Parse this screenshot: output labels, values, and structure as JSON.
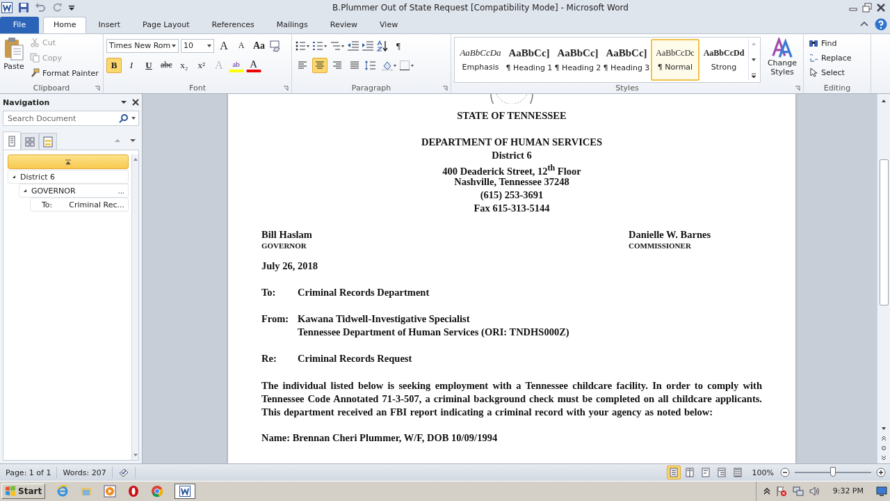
{
  "window": {
    "title": "B.Plummer Out of State Request [Compatibility Mode]  -  Microsoft Word"
  },
  "ribbon_tabs": [
    {
      "label": "File",
      "kind": "file",
      "selected": false
    },
    {
      "label": "Home",
      "kind": "tab",
      "selected": true
    },
    {
      "label": "Insert",
      "kind": "tab",
      "selected": false
    },
    {
      "label": "Page Layout",
      "kind": "tab",
      "selected": false
    },
    {
      "label": "References",
      "kind": "tab",
      "selected": false
    },
    {
      "label": "Mailings",
      "kind": "tab",
      "selected": false
    },
    {
      "label": "Review",
      "kind": "tab",
      "selected": false
    },
    {
      "label": "View",
      "kind": "tab",
      "selected": false
    }
  ],
  "clipboard": {
    "paste": "Paste",
    "cut": "Cut",
    "copy": "Copy",
    "format_painter": "Format Painter",
    "label": "Clipboard"
  },
  "font": {
    "name": "Times New Rom",
    "size": "10",
    "label": "Font",
    "top_buttons": [
      {
        "label": "A",
        "kind": "grow"
      },
      {
        "label": "A",
        "kind": "shrink"
      },
      {
        "label": "Aa",
        "kind": "case"
      }
    ],
    "buttons": [
      {
        "label": "B",
        "kind": "bold",
        "selected": true
      },
      {
        "label": "I",
        "kind": "italic",
        "selected": false
      },
      {
        "label": "U",
        "kind": "underline",
        "selected": false
      },
      {
        "label": "abc",
        "kind": "strike",
        "selected": false
      },
      {
        "label": "x₂",
        "kind": "sub",
        "selected": false
      },
      {
        "label": "x²",
        "kind": "sup",
        "selected": false
      },
      {
        "label": "A",
        "kind": "effects",
        "selected": false
      },
      {
        "label": "ab",
        "kind": "highlight",
        "selected": false
      },
      {
        "label": "A",
        "kind": "color",
        "selected": false
      }
    ]
  },
  "paragraph": {
    "label": "Paragraph",
    "pilcrow": "¶",
    "alignment": [
      {
        "kind": "left",
        "selected": false
      },
      {
        "kind": "center",
        "selected": true
      },
      {
        "kind": "right",
        "selected": false
      },
      {
        "kind": "justify",
        "selected": false
      }
    ]
  },
  "styles": {
    "label": "Styles",
    "change_styles": "Change Styles",
    "items": [
      {
        "preview": "AaBbCcDa",
        "name": "Emphasis",
        "kind": "emphasis",
        "selected": false
      },
      {
        "preview": "AaBbCc]",
        "name": "¶ Heading 1",
        "kind": "heading",
        "selected": false
      },
      {
        "preview": "AaBbCc]",
        "name": "¶ Heading 2",
        "kind": "heading",
        "selected": false
      },
      {
        "preview": "AaBbCc]",
        "name": "¶ Heading 3",
        "kind": "heading",
        "selected": false
      },
      {
        "preview": "AaBbCcDc",
        "name": "¶ Normal",
        "kind": "normal",
        "selected": true
      },
      {
        "preview": "AaBbCcDd",
        "name": "Strong",
        "kind": "strong",
        "selected": false
      }
    ]
  },
  "editing": {
    "label": "Editing",
    "find": "Find",
    "replace": "Replace",
    "select": "Select"
  },
  "navigation": {
    "title": "Navigation",
    "search_placeholder": "Search Document",
    "view_tabs": [
      {
        "kind": "headings",
        "selected": true
      },
      {
        "kind": "pages",
        "selected": false
      },
      {
        "kind": "results",
        "selected": false
      }
    ],
    "tree": [
      {
        "label": "District 6",
        "expanded": true,
        "children": [
          {
            "label": "GOVERNOR",
            "suffix": "...",
            "expanded": true,
            "children": [
              {
                "label": "To:",
                "suffix": "Criminal Rec..."
              }
            ]
          }
        ]
      }
    ]
  },
  "document": {
    "state_line": "STATE  OF TENNESSEE",
    "letterhead": [
      "DEPARTMENT  OF HUMAN SERVICES",
      "District 6",
      "400 Deaderick Street, 12$^{th}$ Floor",
      "Nashville, Tennessee 37248",
      "(615) 253-3691",
      "Fax 615-313-5144"
    ],
    "left_official": {
      "name": "Bill Haslam",
      "title": "GOVERNOR"
    },
    "right_official": {
      "name": "Danielle W. Barnes",
      "title": "COMMISSIONER"
    },
    "date": "July 26, 2018",
    "to": {
      "label": "To:",
      "value": "Criminal  Records Department"
    },
    "from": {
      "label": "From:",
      "value": "Kawana  Tidwell-Investigative  Specialist",
      "value_2": "Tennessee Department of Human  Services (ORI: TNDHS000Z)"
    },
    "re": {
      "label": "Re:",
      "value": "Criminal  Records Request"
    },
    "body": "The  individual  listed  below  is  seeking  employment  with  a  Tennessee  childcare  facility.   In  order  to  comply with Tennessee Code Annotated 71-3-507, a criminal background check must be completed on all childcare  applicants.   This  department  received  an  FBI  report  indicating  a  criminal  record  with  your agency as noted below:",
    "name_line": "Name: Brennan  Cheri Plummer,  W/F,  DOB 10/09/1994"
  },
  "status_bar": {
    "page": "Page: 1 of 1",
    "words": "Words: 207",
    "zoom": "100%",
    "zoom_slider": {
      "level": 0.5
    },
    "views": [
      {
        "kind": "print",
        "selected": true
      },
      {
        "kind": "reading",
        "selected": false
      },
      {
        "kind": "web",
        "selected": false
      },
      {
        "kind": "outline",
        "selected": false
      },
      {
        "kind": "draft",
        "selected": false
      }
    ]
  },
  "taskbar": {
    "start": "Start",
    "time": "9:32 PM"
  }
}
